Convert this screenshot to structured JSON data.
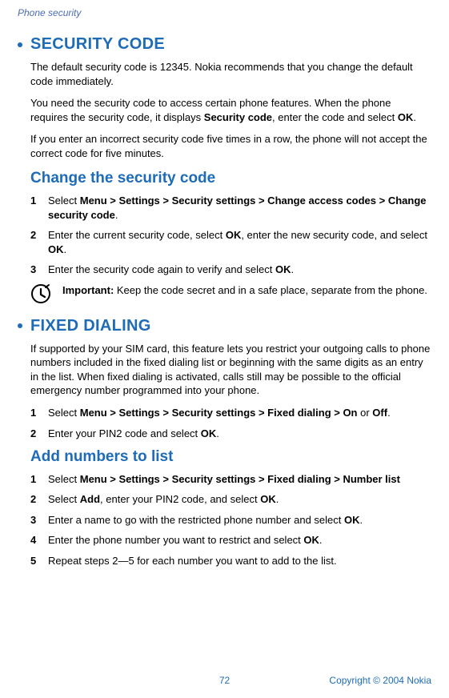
{
  "header": {
    "title": "Phone security"
  },
  "sec1": {
    "heading": "SECURITY CODE",
    "p1_a": "The default security code is 12345. Nokia recommends that you change the default code immediately.",
    "p2_a": "You need the security code to access certain phone features. When the phone requires the security code, it displays ",
    "p2_b": "Security code",
    "p2_c": ", enter the code and select ",
    "p2_d": "OK",
    "p2_e": ".",
    "p3_a": "If you enter an incorrect security code five times in a row, the phone will not accept the correct code for five minutes."
  },
  "sub1": {
    "heading": "Change the security code",
    "i1_a": "Select ",
    "i1_b": "Menu > Settings > Security settings > Change access codes > Change security code",
    "i1_c": ".",
    "i2_a": "Enter the current security code, select ",
    "i2_b": "OK",
    "i2_c": ", enter the new security code, and select ",
    "i2_d": "OK",
    "i2_e": ".",
    "i3_a": "Enter the security code again to verify and select ",
    "i3_b": "OK",
    "i3_c": ".",
    "imp_a": "Important: ",
    "imp_b": "Keep the code secret and in a safe place, separate from the phone."
  },
  "sec2": {
    "heading": "FIXED DIALING",
    "p1": "If supported by your SIM card, this feature lets you restrict your outgoing calls to phone numbers included in the fixed dialing list or beginning with the same digits as an entry in the list. When fixed dialing is activated, calls still may be possible to the official emergency number programmed into your phone.",
    "i1_a": "Select ",
    "i1_b": "Menu > Settings > Security settings > Fixed dialing > On",
    "i1_c": " or ",
    "i1_d": "Off",
    "i1_e": ".",
    "i2_a": "Enter your PIN2 code and select ",
    "i2_b": "OK",
    "i2_c": "."
  },
  "sub2": {
    "heading": "Add numbers to list",
    "i1_a": "Select ",
    "i1_b": "Menu > Settings > Security settings > Fixed dialing > Number list",
    "i2_a": "Select ",
    "i2_b": "Add",
    "i2_c": ", enter your PIN2 code, and select ",
    "i2_d": "OK",
    "i2_e": ".",
    "i3_a": "Enter a name to go with the restricted phone number and select ",
    "i3_b": "OK",
    "i3_c": ".",
    "i4_a": "Enter the phone number you want to restrict and select ",
    "i4_b": "OK",
    "i4_c": ".",
    "i5_a": "Repeat steps 2—5 for each number you want to add to the list."
  },
  "nums": {
    "n1": "1",
    "n2": "2",
    "n3": "3",
    "n4": "4",
    "n5": "5"
  },
  "footer": {
    "page": "72",
    "copyright": "Copyright © 2004 Nokia"
  }
}
